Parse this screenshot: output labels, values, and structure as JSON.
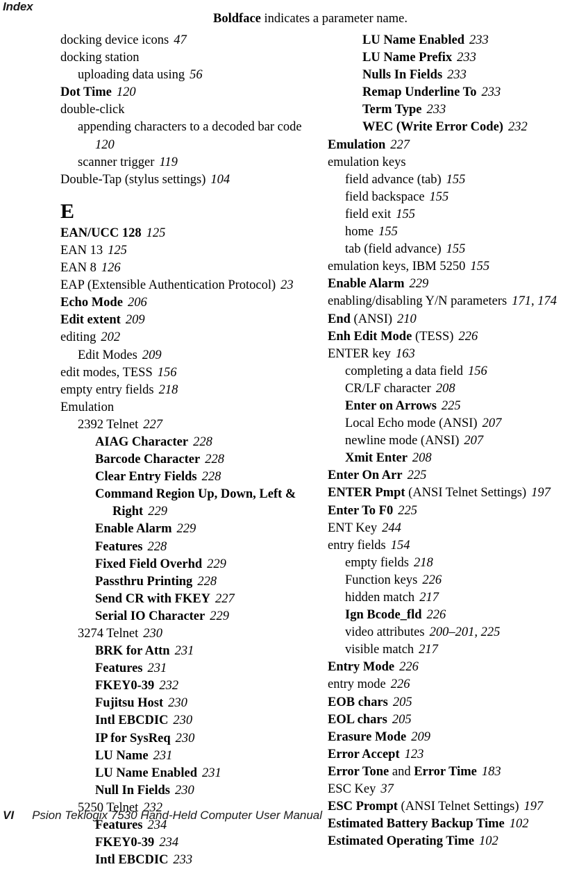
{
  "running_head": "Index",
  "note": {
    "bold_word": "Boldface",
    "rest": " indicates a parameter name."
  },
  "footer": {
    "folio": "VI",
    "title": "Psion Teklogix 7530 Hand-Held Computer User Manual"
  },
  "columns": {
    "left": [
      {
        "level": 0,
        "runs": [
          {
            "t": "docking device icons",
            "s": "n"
          }
        ],
        "page": "47"
      },
      {
        "level": 0,
        "runs": [
          {
            "t": "docking station",
            "s": "n"
          }
        ],
        "page": ""
      },
      {
        "level": 1,
        "runs": [
          {
            "t": "uploading data using",
            "s": "n"
          }
        ],
        "page": "56"
      },
      {
        "level": 0,
        "runs": [
          {
            "t": "Dot Time",
            "s": "b"
          }
        ],
        "page": "120"
      },
      {
        "level": 0,
        "runs": [
          {
            "t": "double-click",
            "s": "n"
          }
        ],
        "page": ""
      },
      {
        "level": 1,
        "runs": [
          {
            "t": "appending characters to a decoded bar code",
            "s": "n"
          }
        ],
        "page": "120",
        "wrap": true
      },
      {
        "level": 1,
        "runs": [
          {
            "t": "scanner trigger",
            "s": "n"
          }
        ],
        "page": "119"
      },
      {
        "level": 0,
        "runs": [
          {
            "t": "Double-Tap (stylus settings)",
            "s": "n"
          }
        ],
        "page": "104"
      },
      {
        "letter": "E"
      },
      {
        "level": 0,
        "runs": [
          {
            "t": "EAN/UCC 128",
            "s": "b"
          }
        ],
        "page": "125"
      },
      {
        "level": 0,
        "runs": [
          {
            "t": "EAN 13",
            "s": "n"
          }
        ],
        "page": "125"
      },
      {
        "level": 0,
        "runs": [
          {
            "t": "EAN 8",
            "s": "n"
          }
        ],
        "page": "126"
      },
      {
        "level": 0,
        "runs": [
          {
            "t": "EAP (Extensible Authentication Protocol)",
            "s": "n"
          }
        ],
        "page": "23",
        "wrap": true
      },
      {
        "level": 0,
        "runs": [
          {
            "t": "Echo Mode",
            "s": "b"
          }
        ],
        "page": "206"
      },
      {
        "level": 0,
        "runs": [
          {
            "t": "Edit extent",
            "s": "b"
          }
        ],
        "page": "209"
      },
      {
        "level": 0,
        "runs": [
          {
            "t": "editing",
            "s": "n"
          }
        ],
        "page": "202"
      },
      {
        "level": 1,
        "runs": [
          {
            "t": "Edit Modes",
            "s": "n"
          }
        ],
        "page": "209"
      },
      {
        "level": 0,
        "runs": [
          {
            "t": "edit modes, TESS",
            "s": "n"
          }
        ],
        "page": "156"
      },
      {
        "level": 0,
        "runs": [
          {
            "t": "empty entry fields",
            "s": "n"
          }
        ],
        "page": "218"
      },
      {
        "level": 0,
        "runs": [
          {
            "t": "Emulation",
            "s": "n"
          }
        ],
        "page": ""
      },
      {
        "level": 1,
        "runs": [
          {
            "t": "2392 Telnet",
            "s": "n"
          }
        ],
        "page": "227"
      },
      {
        "level": 2,
        "runs": [
          {
            "t": "AIAG Character",
            "s": "b"
          }
        ],
        "page": "228"
      },
      {
        "level": 2,
        "runs": [
          {
            "t": "Barcode Character",
            "s": "b"
          }
        ],
        "page": "228"
      },
      {
        "level": 2,
        "runs": [
          {
            "t": "Clear Entry Fields",
            "s": "b"
          }
        ],
        "page": "228"
      },
      {
        "level": 2,
        "runs": [
          {
            "t": "Command Region Up, Down, Left & Right",
            "s": "b"
          }
        ],
        "page": "229",
        "wrap": true
      },
      {
        "level": 2,
        "runs": [
          {
            "t": "Enable Alarm",
            "s": "b"
          }
        ],
        "page": "229"
      },
      {
        "level": 2,
        "runs": [
          {
            "t": "Features",
            "s": "b"
          }
        ],
        "page": "228"
      },
      {
        "level": 2,
        "runs": [
          {
            "t": "Fixed Field Overhd",
            "s": "b"
          }
        ],
        "page": "229"
      },
      {
        "level": 2,
        "runs": [
          {
            "t": "Passthru Printing",
            "s": "b"
          }
        ],
        "page": "228"
      },
      {
        "level": 2,
        "runs": [
          {
            "t": "Send CR with FKEY",
            "s": "b"
          }
        ],
        "page": "227"
      },
      {
        "level": 2,
        "runs": [
          {
            "t": "Serial IO Character",
            "s": "b"
          }
        ],
        "page": "229"
      },
      {
        "level": 1,
        "runs": [
          {
            "t": "3274 Telnet",
            "s": "n"
          }
        ],
        "page": "230"
      },
      {
        "level": 2,
        "runs": [
          {
            "t": "BRK for Attn",
            "s": "b"
          }
        ],
        "page": "231"
      },
      {
        "level": 2,
        "runs": [
          {
            "t": "Features",
            "s": "b"
          }
        ],
        "page": "231"
      },
      {
        "level": 2,
        "runs": [
          {
            "t": "FKEY0-39",
            "s": "b"
          }
        ],
        "page": "232"
      },
      {
        "level": 2,
        "runs": [
          {
            "t": "Fujitsu Host",
            "s": "b"
          }
        ],
        "page": "230"
      },
      {
        "level": 2,
        "runs": [
          {
            "t": "Intl EBCDIC",
            "s": "b"
          }
        ],
        "page": "230"
      },
      {
        "level": 2,
        "runs": [
          {
            "t": "IP for SysReq",
            "s": "b"
          }
        ],
        "page": "230"
      },
      {
        "level": 2,
        "runs": [
          {
            "t": "LU Name",
            "s": "b"
          }
        ],
        "page": "231"
      },
      {
        "level": 2,
        "runs": [
          {
            "t": "LU Name Enabled",
            "s": "b"
          }
        ],
        "page": "231"
      },
      {
        "level": 2,
        "runs": [
          {
            "t": "Null In Fields",
            "s": "b"
          }
        ],
        "page": "230"
      },
      {
        "level": 1,
        "runs": [
          {
            "t": "5250 Telnet",
            "s": "n"
          }
        ],
        "page": "232"
      },
      {
        "level": 2,
        "runs": [
          {
            "t": "Features",
            "s": "b"
          }
        ],
        "page": "234"
      },
      {
        "level": 2,
        "runs": [
          {
            "t": "FKEY0-39",
            "s": "b"
          }
        ],
        "page": "234"
      },
      {
        "level": 2,
        "runs": [
          {
            "t": "Intl EBCDIC",
            "s": "b"
          }
        ],
        "page": "233"
      }
    ],
    "right": [
      {
        "level": 2,
        "runs": [
          {
            "t": "LU Name Enabled",
            "s": "b"
          }
        ],
        "page": "233"
      },
      {
        "level": 2,
        "runs": [
          {
            "t": "LU Name Prefix",
            "s": "b"
          }
        ],
        "page": "233"
      },
      {
        "level": 2,
        "runs": [
          {
            "t": "Nulls In Fields",
            "s": "b"
          }
        ],
        "page": "233"
      },
      {
        "level": 2,
        "runs": [
          {
            "t": "Remap Underline To",
            "s": "b"
          }
        ],
        "page": "233"
      },
      {
        "level": 2,
        "runs": [
          {
            "t": "Term Type",
            "s": "b"
          }
        ],
        "page": "233"
      },
      {
        "level": 2,
        "runs": [
          {
            "t": "WEC (Write Error Code)",
            "s": "b"
          }
        ],
        "page": "232"
      },
      {
        "level": 0,
        "runs": [
          {
            "t": "Emulation",
            "s": "b"
          }
        ],
        "page": "227"
      },
      {
        "level": 0,
        "runs": [
          {
            "t": "emulation keys",
            "s": "n"
          }
        ],
        "page": ""
      },
      {
        "level": 1,
        "runs": [
          {
            "t": "field advance (tab)",
            "s": "n"
          }
        ],
        "page": "155"
      },
      {
        "level": 1,
        "runs": [
          {
            "t": "field backspace",
            "s": "n"
          }
        ],
        "page": "155"
      },
      {
        "level": 1,
        "runs": [
          {
            "t": "field exit",
            "s": "n"
          }
        ],
        "page": "155"
      },
      {
        "level": 1,
        "runs": [
          {
            "t": "home",
            "s": "n"
          }
        ],
        "page": "155"
      },
      {
        "level": 1,
        "runs": [
          {
            "t": "tab (field advance)",
            "s": "n"
          }
        ],
        "page": "155"
      },
      {
        "level": 0,
        "runs": [
          {
            "t": "emulation keys, IBM 5250",
            "s": "n"
          }
        ],
        "page": "155"
      },
      {
        "level": 0,
        "runs": [
          {
            "t": "Enable Alarm",
            "s": "b"
          }
        ],
        "page": "229"
      },
      {
        "level": 0,
        "runs": [
          {
            "t": "enabling/disabling Y/N parameters",
            "s": "n"
          }
        ],
        "page": "171, 174",
        "wrap": true
      },
      {
        "level": 0,
        "runs": [
          {
            "t": "End",
            "s": "b"
          },
          {
            "t": " (ANSI)",
            "s": "n"
          }
        ],
        "page": "210"
      },
      {
        "level": 0,
        "runs": [
          {
            "t": "Enh Edit Mode",
            "s": "b"
          },
          {
            "t": " (TESS)",
            "s": "n"
          }
        ],
        "page": "226"
      },
      {
        "level": 0,
        "runs": [
          {
            "t": "ENTER key",
            "s": "n"
          }
        ],
        "page": "163"
      },
      {
        "level": 1,
        "runs": [
          {
            "t": "completing a data field",
            "s": "n"
          }
        ],
        "page": "156"
      },
      {
        "level": 1,
        "runs": [
          {
            "t": "CR/LF character",
            "s": "n"
          }
        ],
        "page": "208"
      },
      {
        "level": 1,
        "runs": [
          {
            "t": "Enter on Arrows",
            "s": "b"
          }
        ],
        "page": "225"
      },
      {
        "level": 1,
        "runs": [
          {
            "t": "Local Echo mode (ANSI)",
            "s": "n"
          }
        ],
        "page": "207"
      },
      {
        "level": 1,
        "runs": [
          {
            "t": "newline mode (ANSI)",
            "s": "n"
          }
        ],
        "page": "207"
      },
      {
        "level": 1,
        "runs": [
          {
            "t": "Xmit Enter",
            "s": "b"
          }
        ],
        "page": "208"
      },
      {
        "level": 0,
        "runs": [
          {
            "t": "Enter On Arr",
            "s": "b"
          }
        ],
        "page": "225"
      },
      {
        "level": 0,
        "runs": [
          {
            "t": "ENTER Pmpt",
            "s": "b"
          },
          {
            "t": " (ANSI Telnet Settings)",
            "s": "n"
          }
        ],
        "page": "197"
      },
      {
        "level": 0,
        "runs": [
          {
            "t": "Enter To F0",
            "s": "b"
          }
        ],
        "page": "225"
      },
      {
        "level": 0,
        "runs": [
          {
            "t": "ENT Key",
            "s": "n"
          }
        ],
        "page": "244"
      },
      {
        "level": 0,
        "runs": [
          {
            "t": "entry fields",
            "s": "n"
          }
        ],
        "page": "154"
      },
      {
        "level": 1,
        "runs": [
          {
            "t": "empty fields",
            "s": "n"
          }
        ],
        "page": "218"
      },
      {
        "level": 1,
        "runs": [
          {
            "t": "Function keys",
            "s": "n"
          }
        ],
        "page": "226"
      },
      {
        "level": 1,
        "runs": [
          {
            "t": "hidden match",
            "s": "n"
          }
        ],
        "page": "217"
      },
      {
        "level": 1,
        "runs": [
          {
            "t": "Ign Bcode_fld",
            "s": "b"
          }
        ],
        "page": "226"
      },
      {
        "level": 1,
        "runs": [
          {
            "t": "video attributes",
            "s": "n"
          }
        ],
        "page": "200–201, 225"
      },
      {
        "level": 1,
        "runs": [
          {
            "t": "visible match",
            "s": "n"
          }
        ],
        "page": "217"
      },
      {
        "level": 0,
        "runs": [
          {
            "t": "Entry Mode",
            "s": "b"
          }
        ],
        "page": "226"
      },
      {
        "level": 0,
        "runs": [
          {
            "t": "entry mode",
            "s": "n"
          }
        ],
        "page": "226"
      },
      {
        "level": 0,
        "runs": [
          {
            "t": "EOB chars",
            "s": "b"
          }
        ],
        "page": "205"
      },
      {
        "level": 0,
        "runs": [
          {
            "t": "EOL chars",
            "s": "b"
          }
        ],
        "page": "205"
      },
      {
        "level": 0,
        "runs": [
          {
            "t": "Erasure Mode",
            "s": "b"
          }
        ],
        "page": "209"
      },
      {
        "level": 0,
        "runs": [
          {
            "t": "Error Accept",
            "s": "b"
          }
        ],
        "page": "123"
      },
      {
        "level": 0,
        "runs": [
          {
            "t": "Error Tone",
            "s": "b"
          },
          {
            "t": " and ",
            "s": "n"
          },
          {
            "t": "Error Time",
            "s": "b"
          }
        ],
        "page": "183"
      },
      {
        "level": 0,
        "runs": [
          {
            "t": "ESC Key",
            "s": "n"
          }
        ],
        "page": "37"
      },
      {
        "level": 0,
        "runs": [
          {
            "t": "ESC Prompt",
            "s": "b"
          },
          {
            "t": " (ANSI Telnet Settings)",
            "s": "n"
          }
        ],
        "page": "197"
      },
      {
        "level": 0,
        "runs": [
          {
            "t": "Estimated Battery Backup Time",
            "s": "b"
          }
        ],
        "page": "102"
      },
      {
        "level": 0,
        "runs": [
          {
            "t": "Estimated Operating Time",
            "s": "b"
          }
        ],
        "page": "102"
      }
    ]
  }
}
